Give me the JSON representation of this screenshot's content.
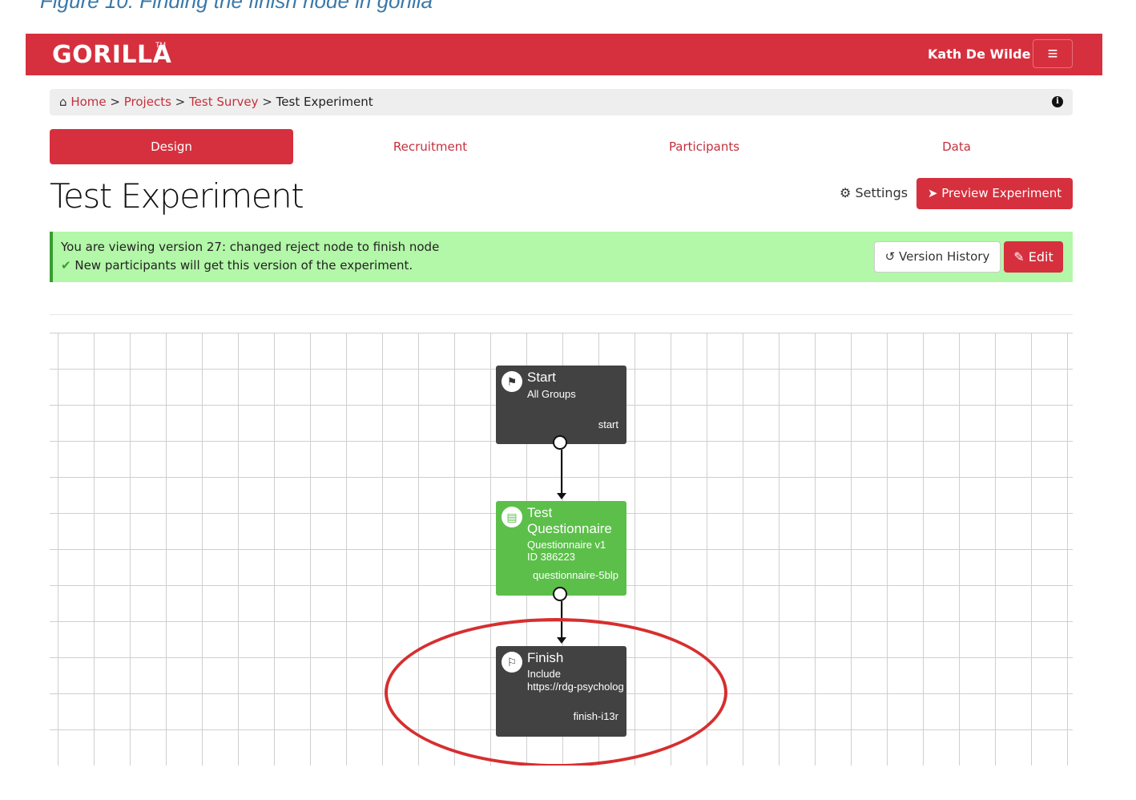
{
  "caption": "Figure 10: Finding the finish node in gorilla",
  "navbar": {
    "brand": "GORILLA",
    "trademark": "TM",
    "user": "Kath De Wilde",
    "menu_icon": "hamburger-icon"
  },
  "breadcrumb": {
    "items": [
      "Home",
      "Projects",
      "Test Survey",
      "Test Experiment"
    ],
    "separator": ">",
    "home_icon": "home-icon",
    "info_icon": "info-icon"
  },
  "tabs": [
    {
      "label": "Design",
      "active": true
    },
    {
      "label": "Recruitment",
      "active": false
    },
    {
      "label": "Participants",
      "active": false
    },
    {
      "label": "Data",
      "active": false
    }
  ],
  "page": {
    "title": "Test Experiment",
    "settings_label": "Settings",
    "preview_label": "Preview Experiment"
  },
  "version": {
    "line1": "You are viewing version 27: changed reject node to finish node",
    "line2": "New participants will get this version of the experiment.",
    "history_label": "Version History",
    "edit_label": "Edit"
  },
  "nodes": [
    {
      "title": "Start",
      "sub": [
        "All Groups"
      ],
      "id": "start",
      "color": "#424242",
      "icon": "flag-icon"
    },
    {
      "title": "Test Questionnaire",
      "sub": [
        "Questionnaire v1",
        "ID 386223"
      ],
      "id": "questionnaire-5blp",
      "color": "#5cbf4a",
      "icon": "list-icon"
    },
    {
      "title": "Finish",
      "sub": [
        "Include",
        "https://rdg-psycholog"
      ],
      "id": "finish-i13r",
      "color": "#424242",
      "icon": "checkered-flag-icon"
    }
  ],
  "colors": {
    "brand_red": "#d6303e",
    "success_green": "#b3f7a8",
    "node_dark": "#424242",
    "node_green": "#5cbf4a",
    "highlight": "#d62f2f"
  }
}
